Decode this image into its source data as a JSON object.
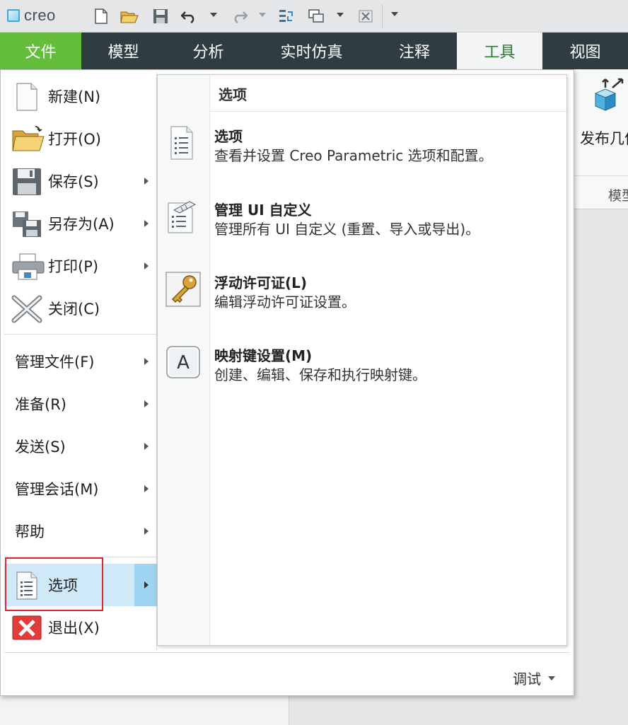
{
  "app": {
    "logo_text": "creo"
  },
  "quick_access": {
    "icons": [
      "new-file-icon",
      "open-folder-icon",
      "save-icon",
      "undo-icon",
      "redo-icon",
      "regenerate-icon",
      "windows-icon",
      "close-window-icon",
      "customize-toolbar-icon"
    ]
  },
  "ribbon": {
    "tabs": [
      {
        "label": "文件"
      },
      {
        "label": "模型"
      },
      {
        "label": "分析"
      },
      {
        "label": "实时仿真"
      },
      {
        "label": "注释"
      },
      {
        "label": "工具"
      },
      {
        "label": "视图"
      }
    ],
    "active_tab": "工具",
    "publish_label": "发布几何",
    "group_label": "模型"
  },
  "file_menu": {
    "items": [
      {
        "label": "新建(N)",
        "icon": "new-document-icon"
      },
      {
        "label": "打开(O)",
        "icon": "open-folder-icon"
      },
      {
        "label": "保存(S)",
        "icon": "save-disk-icon"
      },
      {
        "label": "另存为(A)",
        "icon": "save-as-icon"
      },
      {
        "label": "打印(P)",
        "icon": "printer-icon"
      },
      {
        "label": "关闭(C)",
        "icon": "close-x-icon"
      },
      {
        "label": "管理文件(F)"
      },
      {
        "label": "准备(R)"
      },
      {
        "label": "发送(S)"
      },
      {
        "label": "管理会话(M)"
      },
      {
        "label": "帮助"
      },
      {
        "label": "选项",
        "icon": "options-list-icon"
      },
      {
        "label": "退出(X)",
        "icon": "exit-icon"
      }
    ],
    "selected": "选项",
    "footer_label": "调试"
  },
  "submenu": {
    "header": "选项",
    "items": [
      {
        "title": "选项",
        "description": "查看并设置 Creo Parametric 选项和配置。",
        "icon": "options-list-icon"
      },
      {
        "title": "管理 UI 自定义",
        "description": "管理所有 UI 自定义 (重置、导入或导出)。",
        "icon": "ui-customization-icon"
      },
      {
        "title": "浮动许可证(L)",
        "description": "编辑浮动许可证设置。",
        "icon": "key-icon"
      },
      {
        "title": "映射键设置(M)",
        "description": "创建、编辑、保存和执行映射键。",
        "icon": "mapkey-icon"
      }
    ]
  },
  "colors": {
    "file_tab": "#64bd3b",
    "ribbon_dark": "#2f3c42",
    "active_tab_text": "#2a7d2a",
    "selection": "#cfe9f9",
    "highlight_box": "#e0262e"
  }
}
